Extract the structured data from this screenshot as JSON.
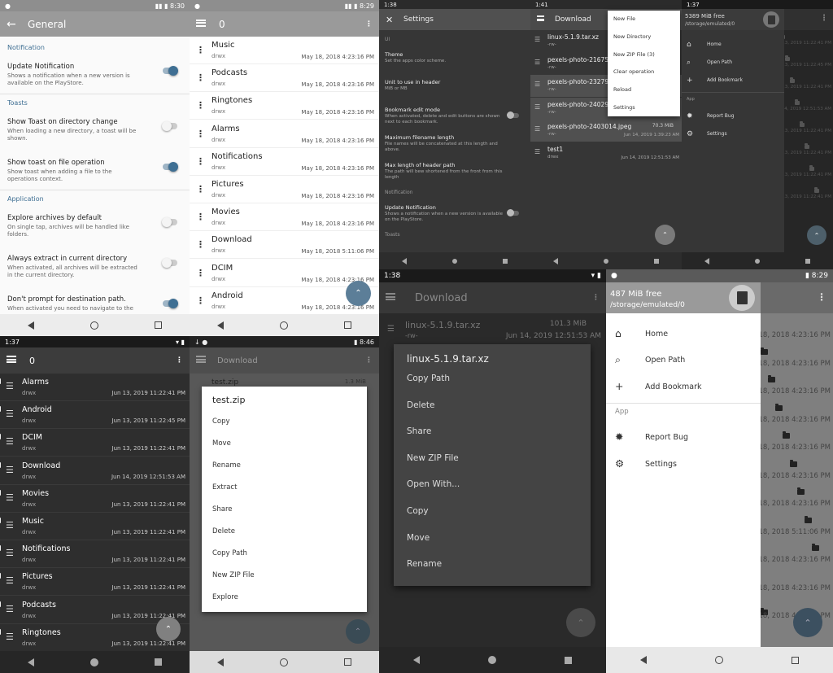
{
  "p1": {
    "status_time": "8:30",
    "title": "General",
    "sections": [
      {
        "header": "Notification",
        "items": [
          {
            "title": "Update Notification",
            "desc": "Shows a notification when a new version is available on the PlayStore.",
            "on": true
          }
        ]
      },
      {
        "header": "Toasts",
        "items": [
          {
            "title": "Show Toast on directory change",
            "desc": "When loading a new directory, a toast will be shown.",
            "on": false
          },
          {
            "title": "Show toast on file operation",
            "desc": "Show toast when adding a file to the operations context.",
            "on": true
          }
        ]
      },
      {
        "header": "Application",
        "items": [
          {
            "title": "Explore archives by default",
            "desc": "On single tap, archives will be handled like folders.",
            "on": false
          },
          {
            "title": "Always extract in current directory",
            "desc": "When activated, all archives will be extracted in the current directory.",
            "on": false
          },
          {
            "title": "Don't prompt for destination path.",
            "desc": "When activated you need to navigate to the",
            "on": true
          }
        ]
      }
    ]
  },
  "p2": {
    "status_time": "8:29",
    "title": "0",
    "items": [
      {
        "name": "Music",
        "perm": "drwx",
        "date": "May 18, 2018 4:23:16 PM"
      },
      {
        "name": "Podcasts",
        "perm": "drwx",
        "date": "May 18, 2018 4:23:16 PM"
      },
      {
        "name": "Ringtones",
        "perm": "drwx",
        "date": "May 18, 2018 4:23:16 PM"
      },
      {
        "name": "Alarms",
        "perm": "drwx",
        "date": "May 18, 2018 4:23:16 PM"
      },
      {
        "name": "Notifications",
        "perm": "drwx",
        "date": "May 18, 2018 4:23:16 PM"
      },
      {
        "name": "Pictures",
        "perm": "drwx",
        "date": "May 18, 2018 4:23:16 PM"
      },
      {
        "name": "Movies",
        "perm": "drwx",
        "date": "May 18, 2018 4:23:16 PM"
      },
      {
        "name": "Download",
        "perm": "drwx",
        "date": "May 18, 2018 5:11:06 PM"
      },
      {
        "name": "DCIM",
        "perm": "drwx",
        "date": "May 18, 2018 4:23:16 PM"
      },
      {
        "name": "Android",
        "perm": "drwx",
        "date": "May 18, 2018 4:23:16 PM"
      }
    ]
  },
  "p3": {
    "status_time": "1:38",
    "title": "Settings",
    "items": [
      {
        "type": "header",
        "text": "UI"
      },
      {
        "title": "Theme",
        "desc": "Set the apps color scheme."
      },
      {
        "title": "Unit to use in header",
        "desc": "MiB or MB"
      },
      {
        "title": "Bookmark edit mode",
        "desc": "When activated, delete and edit buttons are shown next to each bookmark.",
        "toggle": false
      },
      {
        "title": "Maximum filename length",
        "desc": "File names will be concatenated at this length and above."
      },
      {
        "title": "Max length of header path",
        "desc": "The path will bew shortened from the front from this length"
      },
      {
        "type": "header",
        "text": "Notification"
      },
      {
        "title": "Update Notification",
        "desc": "Shows a notification when a new version is available on the PlayStore.",
        "toggle": false
      },
      {
        "type": "header",
        "text": "Toasts"
      }
    ]
  },
  "p4": {
    "status_time": "1:41",
    "title": "Download",
    "files": [
      {
        "name": "linux-5.1.9.tar.xz",
        "perm": "-rw-",
        "size": "",
        "date": ""
      },
      {
        "name": "pexels-photo-216750",
        "perm": "-rw-",
        "size": "",
        "date": ""
      },
      {
        "name": "pexels-photo-23279",
        "perm": "-rw-",
        "size": "",
        "date": ""
      },
      {
        "name": "pexels-photo-240295",
        "perm": "-rw-",
        "size": "",
        "date": ""
      },
      {
        "name": "pexels-photo-2403014.jpeg",
        "perm": "-rw-",
        "size": "70.3 MiB",
        "date": "Jun 14, 2019 1:39:23 AM"
      },
      {
        "name": "test1",
        "perm": "drwx",
        "size": "",
        "date": "Jun 14, 2019 12:51:53 AM"
      }
    ],
    "menu": [
      "New File",
      "New Directory",
      "New ZIP File (3)",
      "Clear operation",
      "Reload",
      "Settings"
    ]
  },
  "p5": {
    "status_time": "1:37",
    "drawer": {
      "free": "5389 MiB free",
      "path": "/storage/emulated/0",
      "items": [
        "Home",
        "Open Path",
        "Add Bookmark"
      ],
      "app_header": "App",
      "app_items": [
        "Report Bug",
        "Settings"
      ]
    },
    "times": [
      "Jun 13, 2019 11:22:41 PM",
      "Jun 13, 2019 11:22:45 PM",
      "Jun 13, 2019 11:22:41 PM",
      "Jun 14, 2019 12:51:53 AM",
      "Jun 13, 2019 11:22:41 PM",
      "Jun 13, 2019 11:22:41 PM",
      "Jun 13, 2019 11:22:41 PM",
      "Jun 13, 2019 11:22:41 PM"
    ]
  },
  "p6": {
    "status_time": "1:37",
    "title": "0",
    "items": [
      {
        "name": "Alarms",
        "perm": "drwx",
        "date": "Jun 13, 2019 11:22:41 PM"
      },
      {
        "name": "Android",
        "perm": "drwx",
        "date": "Jun 13, 2019 11:22:45 PM"
      },
      {
        "name": "DCIM",
        "perm": "drwx",
        "date": "Jun 13, 2019 11:22:41 PM"
      },
      {
        "name": "Download",
        "perm": "drwx",
        "date": "Jun 14, 2019 12:51:53 AM"
      },
      {
        "name": "Movies",
        "perm": "drwx",
        "date": "Jun 13, 2019 11:22:41 PM"
      },
      {
        "name": "Music",
        "perm": "drwx",
        "date": "Jun 13, 2019 11:22:41 PM"
      },
      {
        "name": "Notifications",
        "perm": "drwx",
        "date": "Jun 13, 2019 11:22:41 PM"
      },
      {
        "name": "Pictures",
        "perm": "drwx",
        "date": "Jun 13, 2019 11:22:41 PM"
      },
      {
        "name": "Podcasts",
        "perm": "drwx",
        "date": "Jun 13, 2019 11:22:41 PM"
      },
      {
        "name": "Ringtones",
        "perm": "drwx",
        "date": "Jun 13, 2019 11:22:41 PM"
      }
    ]
  },
  "p7": {
    "status_time": "8:46",
    "title": "Download",
    "bg_file": {
      "name": "test.zip",
      "size": "1.3 MiB"
    },
    "dialog_title": "test.zip",
    "options": [
      "Copy",
      "Move",
      "Rename",
      "Extract",
      "Share",
      "Delete",
      "Copy Path",
      "New ZIP File",
      "Explore"
    ]
  },
  "p8": {
    "status_time": "1:38",
    "title": "Download",
    "bg_file": {
      "name": "linux-5.1.9.tar.xz",
      "perm": "-rw-",
      "size": "101.3 MiB",
      "date": "Jun 14, 2019 12:51:53 AM"
    },
    "dialog_title": "linux-5.1.9.tar.xz",
    "options": [
      "Copy Path",
      "Delete",
      "Share",
      "New ZIP File",
      "Open With...",
      "Copy",
      "Move",
      "Rename"
    ]
  },
  "p9": {
    "status_time": "8:29",
    "drawer": {
      "free": "487 MiB free",
      "path": "/storage/emulated/0",
      "items": [
        "Home",
        "Open Path",
        "Add Bookmark"
      ],
      "app_header": "App",
      "app_items": [
        "Report Bug",
        "Settings"
      ]
    },
    "dates": [
      "May 18, 2018 4:23:16 PM",
      "May 18, 2018 4:23:16 PM",
      "May 18, 2018 4:23:16 PM",
      "May 18, 2018 4:23:16 PM",
      "May 18, 2018 4:23:16 PM",
      "May 18, 2018 4:23:16 PM",
      "May 18, 2018 4:23:16 PM",
      "May 18, 2018 5:11:06 PM",
      "May 18, 2018 4:23:16 PM",
      "May 18, 2018 4:23:16 PM",
      "May 18, 2018 4:23:16 PM"
    ]
  },
  "colors": {
    "accent_light": "#3f6f93",
    "accent_dark": "#4a6b7f",
    "toolbar_light": "#9a9a9a",
    "dark_bg": "#363636",
    "darker_bg": "#2d2d2d"
  }
}
